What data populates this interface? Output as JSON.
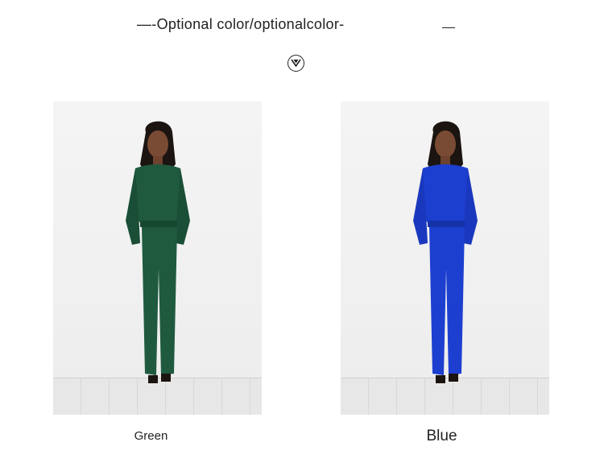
{
  "header": {
    "title": "—-Optional color/optionalcolor-",
    "trailing_dash": "—",
    "icon": "chevron-down-icon"
  },
  "products": [
    {
      "label": "Green",
      "color": "#1f5a3f",
      "accent": "#16482f"
    },
    {
      "label": "Blue",
      "color": "#1d3fd0",
      "accent": "#1532a8"
    }
  ]
}
